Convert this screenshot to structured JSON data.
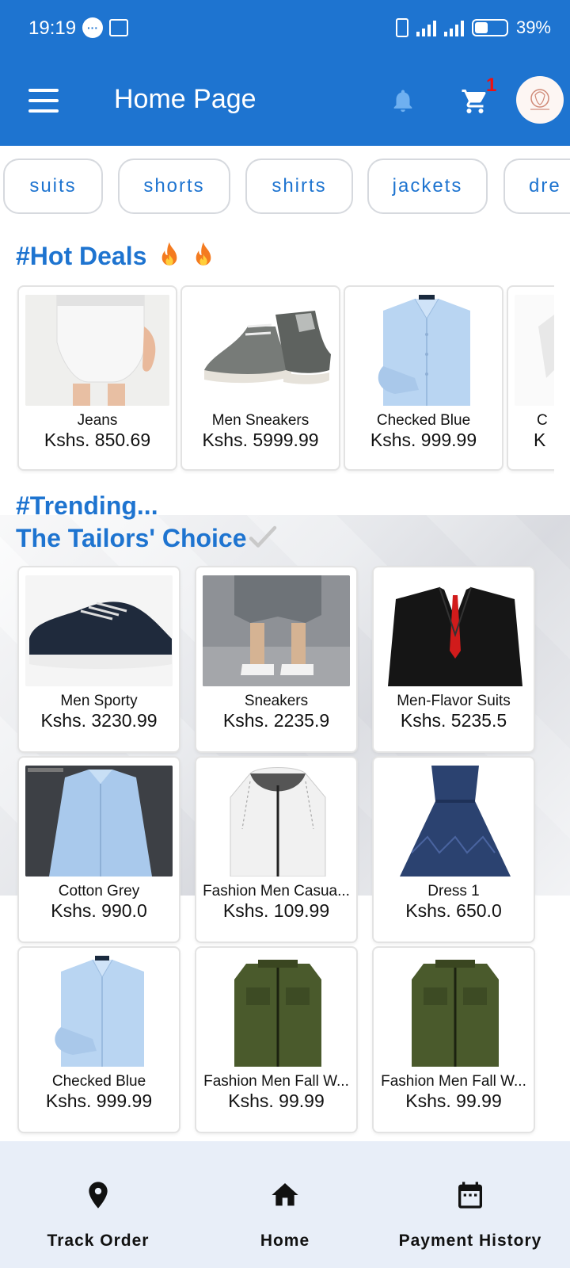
{
  "status_bar": {
    "time": "19:19",
    "battery": "39%"
  },
  "app_bar": {
    "title": "Home Page",
    "cart_count": "1"
  },
  "categories": [
    "suits",
    "shorts",
    "shirts",
    "jackets",
    "dre"
  ],
  "hot_deals": {
    "title": "#Hot Deals",
    "items": [
      {
        "name": "Jeans",
        "price": "Kshs. 850.69"
      },
      {
        "name": "Men Sneakers",
        "price": "Kshs. 5999.99"
      },
      {
        "name": "Checked Blue",
        "price": "Kshs. 999.99"
      },
      {
        "name": "C",
        "price": "K"
      }
    ]
  },
  "trending": {
    "title": "#Trending...",
    "subtitle": "The Tailors' Choice",
    "items": [
      {
        "name": "Men Sporty",
        "price": "Kshs. 3230.99"
      },
      {
        "name": "Sneakers",
        "price": "Kshs. 2235.9"
      },
      {
        "name": "Men-Flavor Suits",
        "price": "Kshs. 5235.5"
      },
      {
        "name": "Cotton Grey",
        "price": "Kshs. 990.0"
      },
      {
        "name": "Fashion Men Casua...",
        "price": "Kshs. 109.99"
      },
      {
        "name": "Dress 1",
        "price": "Kshs. 650.0"
      },
      {
        "name": "Checked Blue",
        "price": "Kshs. 999.99"
      },
      {
        "name": "Fashion Men Fall W...",
        "price": "Kshs. 99.99"
      },
      {
        "name": "Fashion Men Fall W...",
        "price": "Kshs. 99.99"
      }
    ]
  },
  "bottom_nav": [
    {
      "label": "Track Order",
      "icon": "location-pin-icon"
    },
    {
      "label": "Home",
      "icon": "home-icon"
    },
    {
      "label": "Payment History",
      "icon": "calendar-icon"
    }
  ],
  "colors": {
    "primary": "#1e74d0",
    "badge": "#ee1111",
    "nav_bg": "#e8eef8"
  }
}
